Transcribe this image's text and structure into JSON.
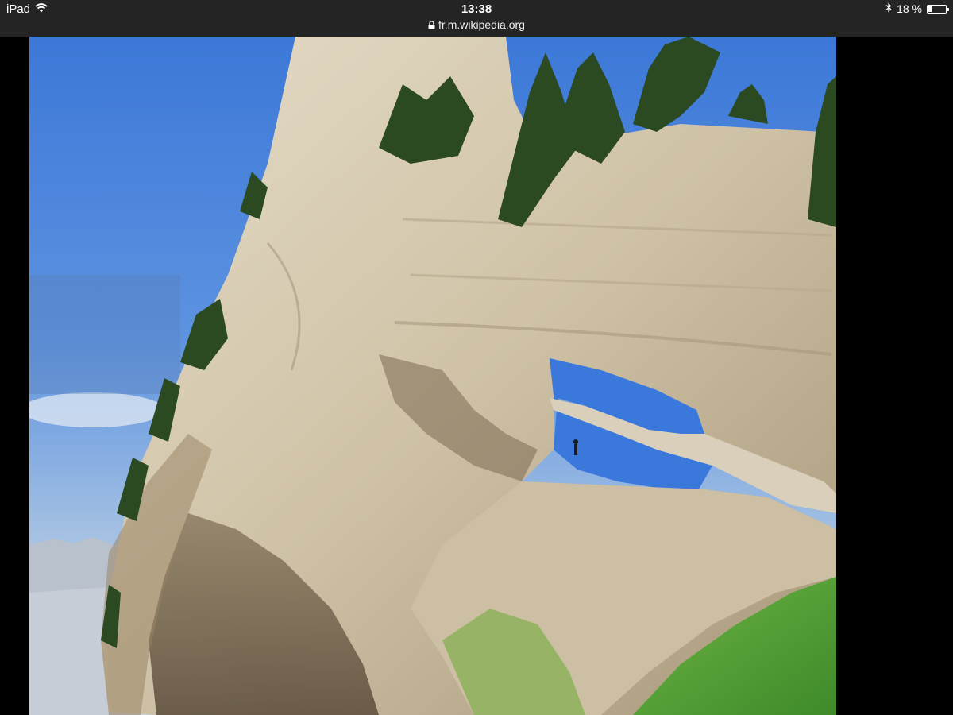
{
  "status_bar": {
    "device": "iPad",
    "wifi_icon": "wifi-icon",
    "time": "13:38",
    "url": "fr.m.wikipedia.org",
    "lock_icon": "lock-icon",
    "bluetooth_icon": "bluetooth-icon",
    "battery_text": "18 %",
    "battery_level": 0.18
  },
  "image": {
    "subject": "limestone natural arch with a person standing beneath it, pine trees on the cliff top, blue sky, grassy slope",
    "colors": {
      "sky": "#3f79d6",
      "rock": "#d8cdb7",
      "grass": "#5ea43a",
      "tree": "#2c4a22"
    }
  }
}
